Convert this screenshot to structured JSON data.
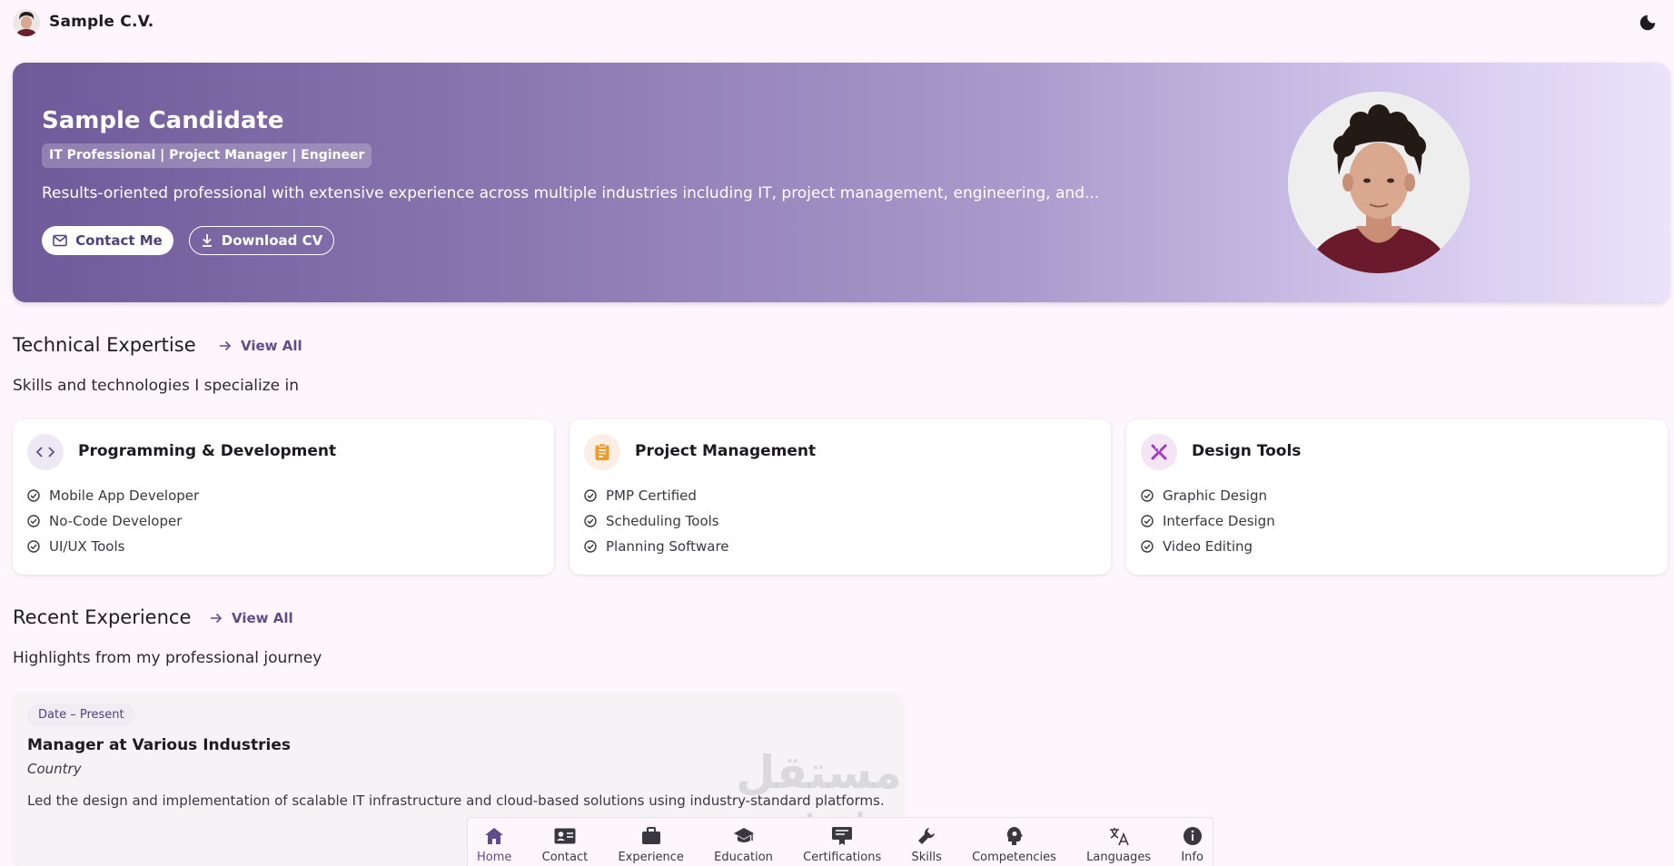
{
  "app": {
    "title": "Sample C.V."
  },
  "hero": {
    "name": "Sample Candidate",
    "headline": "IT Professional | Project Manager | Engineer",
    "summary": "Results-oriented professional with extensive experience across multiple industries including IT, project management, engineering, and...",
    "contact_label": "Contact Me",
    "download_label": "Download CV"
  },
  "technical": {
    "title": "Technical Expertise",
    "view_all": "View All",
    "subtitle": "Skills and technologies I specialize in",
    "cards": [
      {
        "title": "Programming & Development",
        "icon": "code-icon",
        "items": [
          "Mobile App Developer",
          "No-Code Developer",
          "UI/UX Tools"
        ]
      },
      {
        "title": "Project Management",
        "icon": "clipboard-icon",
        "items": [
          "PMP Certified",
          "Scheduling Tools",
          "Planning Software"
        ]
      },
      {
        "title": "Design Tools",
        "icon": "design-tools-icon",
        "items": [
          "Graphic Design",
          "Interface Design",
          "Video Editing"
        ]
      }
    ]
  },
  "experience": {
    "title": "Recent Experience",
    "view_all": "View All",
    "subtitle": "Highlights from my professional journey",
    "items": [
      {
        "date": "Date – Present",
        "title": "Manager at Various Industries",
        "location": "Country",
        "description": "Led the design and implementation of scalable IT infrastructure and cloud-based solutions using industry-standard platforms."
      }
    ]
  },
  "watermark": {
    "arabic": "مستقل",
    "latin": "mostaql.com"
  },
  "nav": {
    "items": [
      {
        "label": "Home",
        "icon": "home-icon",
        "active": true
      },
      {
        "label": "Contact",
        "icon": "contact-card-icon",
        "active": false
      },
      {
        "label": "Experience",
        "icon": "briefcase-icon",
        "active": false
      },
      {
        "label": "Education",
        "icon": "graduation-cap-icon",
        "active": false
      },
      {
        "label": "Certifications",
        "icon": "certificate-icon",
        "active": false
      },
      {
        "label": "Skills",
        "icon": "wrench-icon",
        "active": false
      },
      {
        "label": "Competencies",
        "icon": "brain-icon",
        "active": false
      },
      {
        "label": "Languages",
        "icon": "translate-icon",
        "active": false
      },
      {
        "label": "Info",
        "icon": "info-icon",
        "active": false
      }
    ]
  },
  "colors": {
    "accent": "#5f4c8c",
    "hero_gradient_start": "#6f5a9a",
    "hero_gradient_end": "#ebe3fb",
    "background": "#fdf7fd",
    "project_icon": "#f09a2a",
    "design_icon": "#a23cc4"
  }
}
